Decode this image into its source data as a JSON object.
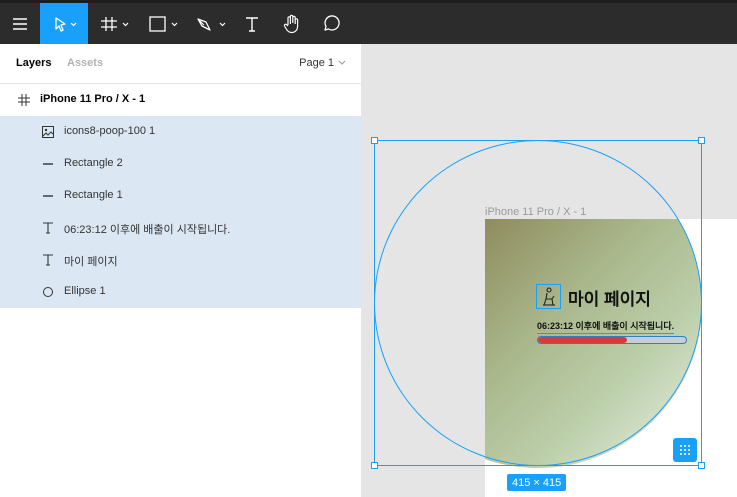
{
  "toolbar": {
    "tools": [
      "menu-icon",
      "move-tool-icon",
      "frame-tool-icon",
      "shape-tool-icon",
      "pen-tool-icon",
      "text-tool-icon",
      "hand-tool-icon",
      "comment-tool-icon"
    ],
    "active_tool": "move-tool-icon",
    "accent": "#18a0fb",
    "background": "#2c2c2c"
  },
  "left_panel": {
    "tabs": {
      "layers": "Layers",
      "assets": "Assets"
    },
    "page": "Page 1",
    "layers": [
      {
        "name": "iPhone 11 Pro / X - 1",
        "icon": "frame-icon",
        "selected": false
      },
      {
        "name": "icons8-poop-100 1",
        "icon": "image-icon",
        "selected": true
      },
      {
        "name": "Rectangle 2",
        "icon": "line-icon",
        "selected": true
      },
      {
        "name": "Rectangle 1",
        "icon": "line-icon",
        "selected": true
      },
      {
        "name": "06:23:12 이후에 배출이 시작됩니다.",
        "icon": "text-icon",
        "selected": true
      },
      {
        "name": "마이 페이지",
        "icon": "text-icon",
        "selected": true
      },
      {
        "name": "Ellipse 1",
        "icon": "ellipse-icon",
        "selected": true
      }
    ]
  },
  "canvas": {
    "frame_title": "iPhone 11 Pro / X - 1",
    "my_page": "마이 페이지",
    "status_text": "06:23:12 이후에 배출이 시작됩니다.",
    "progress": 0.6,
    "progress_color": "#d93b3b",
    "selection_size": "415 × 415"
  }
}
